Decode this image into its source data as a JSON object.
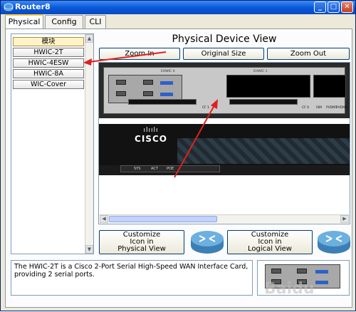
{
  "window": {
    "title": "Router8",
    "minimize_label": "_",
    "maximize_label": "□",
    "close_label": "✕"
  },
  "tabs": [
    {
      "label": "Physical",
      "active": true
    },
    {
      "label": "Config",
      "active": false
    },
    {
      "label": "CLI",
      "active": false
    }
  ],
  "modules": {
    "items": [
      {
        "label": "模块"
      },
      {
        "label": "HWIC-2T"
      },
      {
        "label": "HWIC-4ESW"
      },
      {
        "label": "HWIC-8A"
      },
      {
        "label": "WIC-Cover"
      }
    ]
  },
  "device_view": {
    "title": "Physical Device View",
    "zoom_in_label": "Zoom In",
    "original_size_label": "Original Size",
    "zoom_out_label": "Zoom Out"
  },
  "router_graphic": {
    "slot_labels": [
      "EHWIC 0",
      "EHWIC 1",
      "EHWIC 2"
    ],
    "port_labels": [
      "CF 1",
      "CF 0",
      "ISM",
      "PVDM1",
      "PVDM0"
    ],
    "brand": "CISCO",
    "brand_bars": "ılıılı",
    "front_leds": [
      "SYS",
      "ACT",
      "POE"
    ]
  },
  "customize": {
    "physical_label_line1": "Customize",
    "physical_label_line2": "Icon in",
    "physical_label_line3": "Physical View",
    "logical_label_line1": "Customize",
    "logical_label_line2": "Icon in",
    "logical_label_line3": "Logical View"
  },
  "description": {
    "text": "The HWIC-2T is a Cisco 2-Port Serial High-Speed WAN Interface Card, providing 2 serial ports."
  },
  "watermark": "Baidu",
  "colors": {
    "titlebar": "#0a5ad8",
    "annotation_arrow": "#e02020",
    "router_body": "#2a2a2a",
    "card_accent": "#2d61c8"
  }
}
